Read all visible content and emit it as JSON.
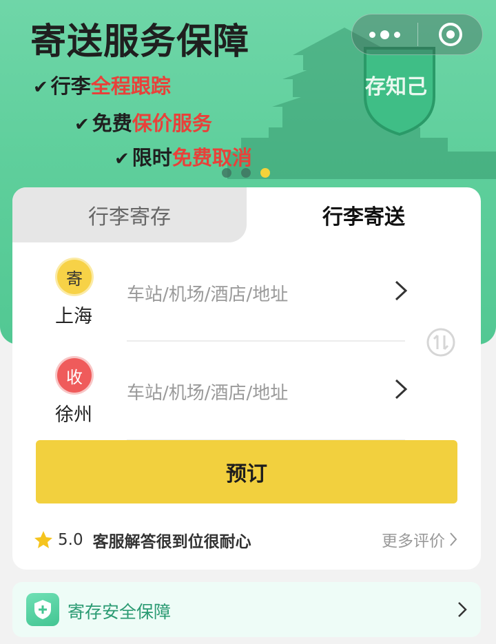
{
  "banner": {
    "title": "寄送服务保障",
    "features": [
      {
        "prefix": "行李",
        "highlight": "全程跟踪"
      },
      {
        "prefix": "免费",
        "highlight": "保价服务"
      },
      {
        "prefix": "限时",
        "highlight": "免费取消"
      }
    ],
    "shield_text": "存知己",
    "carousel": {
      "count": 3,
      "active": 3
    }
  },
  "capsule": {
    "more_icon": "more-dots-icon",
    "close_icon": "close-target-icon"
  },
  "tabs": [
    {
      "label": "行李寄存",
      "active": false
    },
    {
      "label": "行李寄送",
      "active": true
    }
  ],
  "route": {
    "from": {
      "badge": "寄",
      "city": "上海",
      "placeholder": "车站/机场/酒店/地址"
    },
    "to": {
      "badge": "收",
      "city": "徐州",
      "placeholder": "车站/机场/酒店/地址"
    },
    "swap_icon": "swap-icon"
  },
  "book_button": {
    "label": "预订"
  },
  "review": {
    "score": "5.0",
    "text": "客服解答很到位很耐心",
    "more_label": "更多评价"
  },
  "safety": {
    "label": "寄存安全保障"
  },
  "colors": {
    "brand_green": "#5fcf9c",
    "accent_yellow": "#f2d03e",
    "highlight_red": "#e8413a",
    "safety_text": "#2a9a72"
  }
}
